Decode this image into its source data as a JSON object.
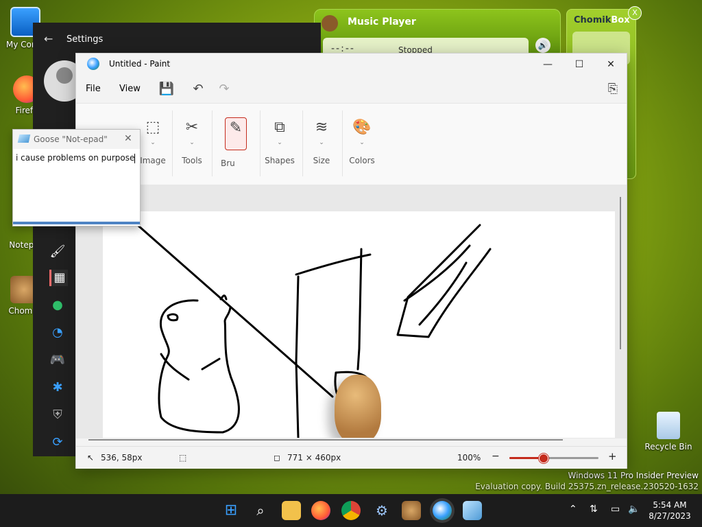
{
  "desktop": {
    "icons": [
      {
        "label": "My Comp"
      },
      {
        "label": "Firefo"
      },
      {
        "label": "Notepa"
      },
      {
        "label": "Chomik"
      },
      {
        "label": "Recycle Bin"
      }
    ],
    "watermark": {
      "line1": "Windows 11 Pro Insider Preview",
      "line2": "Evaluation copy. Build 25375.zn_release.230520-1632"
    }
  },
  "settings": {
    "title": "Settings",
    "back_icon": "arrow-left-icon"
  },
  "music_player": {
    "title": "Music Player",
    "time": "--:--",
    "status": "Stopped"
  },
  "chomikbox": {
    "title_part1": "Chomik",
    "title_part2": "Box",
    "close": "X"
  },
  "paint": {
    "title": "Untitled - Paint",
    "menu": {
      "file": "File",
      "view": "View"
    },
    "ribbon": {
      "image": "Image",
      "tools": "Tools",
      "brushes": "Bru",
      "shapes": "Shapes",
      "size": "Size",
      "colors": "Colors"
    },
    "status": {
      "cursor": "536, 58px",
      "canvas_size": "771 × 460px",
      "zoom": "100%"
    },
    "zoom_fraction": 0.38,
    "accent": "#c42b1c"
  },
  "notepad": {
    "title": "Goose \"Not-epad\"",
    "text": "i cause problems on purpose"
  },
  "taskbar": {
    "time": "5:54 AM",
    "date": "8/27/2023"
  }
}
